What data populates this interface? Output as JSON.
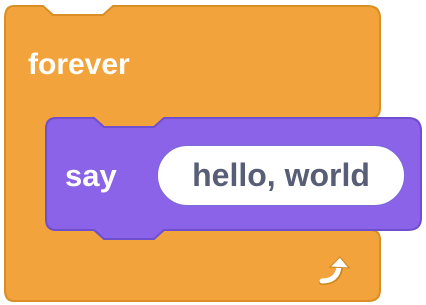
{
  "forever_block": {
    "label": "forever",
    "color": "#f2a33b",
    "border_color": "#d98f26"
  },
  "say_block": {
    "label": "say",
    "input_value": "hello, world",
    "color": "#8a63e8",
    "border_color": "#6f4fce"
  },
  "icons": {
    "loop": "loop-arrow-icon"
  }
}
